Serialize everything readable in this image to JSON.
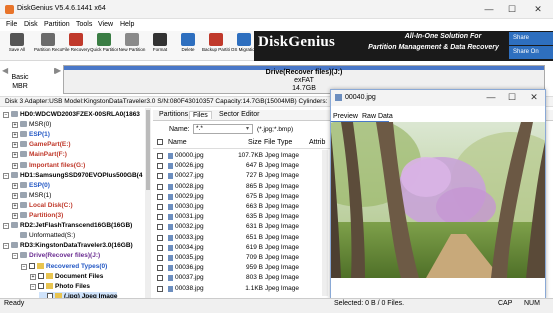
{
  "window": {
    "title": "DiskGenius V5.4.6.1441 x64",
    "min": "—",
    "max": "☐",
    "close": "✕"
  },
  "menu": [
    "File",
    "Disk",
    "Partition",
    "Tools",
    "View",
    "Help"
  ],
  "toolbar": [
    {
      "label": "Save All",
      "icon": "save-icon",
      "color": "#555555"
    },
    {
      "label": "Partition Recovery",
      "icon": "partition-recovery-icon",
      "color": "#6b6b6b"
    },
    {
      "label": "File Recovery",
      "icon": "file-recovery-icon",
      "color": "#c0392b"
    },
    {
      "label": "Quick Partition",
      "icon": "quick-partition-icon",
      "color": "#3a7d44"
    },
    {
      "label": "New Partition",
      "icon": "new-partition-icon",
      "color": "#8a8a8a"
    },
    {
      "label": "Format",
      "icon": "format-icon",
      "color": "#333333"
    },
    {
      "label": "Delete",
      "icon": "delete-icon",
      "color": "#2e6fbf"
    },
    {
      "label": "Backup Partition",
      "icon": "backup-partition-icon",
      "color": "#c0392b"
    },
    {
      "label": "OS Migration",
      "icon": "os-migration-icon",
      "color": "#2e6fbf"
    }
  ],
  "banner": {
    "brand": "DiskGenius",
    "tagline1": "All-In-One Solution For",
    "tagline2": "Partition Management & Data Recovery",
    "social": [
      "Share",
      "Share On"
    ]
  },
  "diskmap": {
    "basic": "Basic",
    "mbr": "MBR",
    "partition_name": "Drive(Recover files)(J:)",
    "partition_fs": "exFAT",
    "partition_size": "14.7GB"
  },
  "disk_info": "Disk 3 Adapter:USB  Model:KingstonDataTraveler3.0  S/N:080F43010357  Capacity:14.7GB(15004MB)  Cylinders:",
  "tree": [
    {
      "label": "HD0:WDCWD2003FZEX-00SRLA0(1863",
      "kind": "disk",
      "pm": "-",
      "indent": 0,
      "color": ""
    },
    {
      "label": "MSR(0)",
      "kind": "part",
      "pm": "+",
      "indent": 1,
      "color": ""
    },
    {
      "label": "ESP(1)",
      "kind": "part",
      "pm": "+",
      "indent": 1,
      "color": "blue"
    },
    {
      "label": "GamePart(E:)",
      "kind": "part",
      "pm": "+",
      "indent": 1,
      "color": "red"
    },
    {
      "label": "MainPart(F:)",
      "kind": "part",
      "pm": "+",
      "indent": 1,
      "color": "red"
    },
    {
      "label": "Important files(G:)",
      "kind": "part",
      "pm": "+",
      "indent": 1,
      "color": "red"
    },
    {
      "label": "HD1:SamsungSSD970EVOPlus500GB(4",
      "kind": "disk",
      "pm": "-",
      "indent": 0,
      "color": ""
    },
    {
      "label": "ESP(0)",
      "kind": "part",
      "pm": "+",
      "indent": 1,
      "color": "blue"
    },
    {
      "label": "MSR(1)",
      "kind": "part",
      "pm": "+",
      "indent": 1,
      "color": ""
    },
    {
      "label": "Local Disk(C:)",
      "kind": "part",
      "pm": "+",
      "indent": 1,
      "color": "red"
    },
    {
      "label": "Partition(3)",
      "kind": "part",
      "pm": "+",
      "indent": 1,
      "color": "red"
    },
    {
      "label": "RD2:JetFlashTranscend16GB(16GB)",
      "kind": "disk",
      "pm": "-",
      "indent": 0,
      "color": ""
    },
    {
      "label": "Unformatted(S:)",
      "kind": "part",
      "pm": "",
      "indent": 1,
      "color": ""
    },
    {
      "label": "RD3:KingstonDataTraveler3.0(16GB)",
      "kind": "disk",
      "pm": "-",
      "indent": 0,
      "color": ""
    },
    {
      "label": "Drive(Recover files)(J:)",
      "kind": "part",
      "pm": "-",
      "indent": 1,
      "color": "purple"
    },
    {
      "label": "Recovered Types(0)",
      "kind": "folder",
      "pm": "-",
      "indent": 2,
      "color": "blue",
      "cb": true
    },
    {
      "label": "Document Files",
      "kind": "folder",
      "pm": "+",
      "indent": 3,
      "color": "",
      "cb": true
    },
    {
      "label": "Photo Files",
      "kind": "folder",
      "pm": "-",
      "indent": 3,
      "color": "",
      "cb": true
    },
    {
      "label": "(.jpg) Jpeg Image",
      "kind": "folder",
      "pm": "",
      "indent": 4,
      "color": "",
      "cb": true,
      "hl": true
    }
  ],
  "tabs": [
    "Partitions",
    "Files",
    "Sector Editor"
  ],
  "active_tab": 1,
  "filter": {
    "label": "Name:",
    "value": "*.*",
    "hint": "(*.jpg;*.bmp)"
  },
  "columns": [
    "Name",
    "Size",
    "File Type",
    "Attrib"
  ],
  "files": [
    {
      "name": "00000.jpg",
      "size": "107.7KB",
      "type": "Jpeg Image"
    },
    {
      "name": "00026.jpg",
      "size": "647 B",
      "type": "Jpeg Image"
    },
    {
      "name": "00027.jpg",
      "size": "727 B",
      "type": "Jpeg Image"
    },
    {
      "name": "00028.jpg",
      "size": "865 B",
      "type": "Jpeg Image"
    },
    {
      "name": "00029.jpg",
      "size": "675 B",
      "type": "Jpeg Image"
    },
    {
      "name": "00030.jpg",
      "size": "663 B",
      "type": "Jpeg Image"
    },
    {
      "name": "00031.jpg",
      "size": "635 B",
      "type": "Jpeg Image"
    },
    {
      "name": "00032.jpg",
      "size": "631 B",
      "type": "Jpeg Image"
    },
    {
      "name": "00033.jpg",
      "size": "651 B",
      "type": "Jpeg Image"
    },
    {
      "name": "00034.jpg",
      "size": "619 B",
      "type": "Jpeg Image"
    },
    {
      "name": "00035.jpg",
      "size": "709 B",
      "type": "Jpeg Image"
    },
    {
      "name": "00036.jpg",
      "size": "959 B",
      "type": "Jpeg Image"
    },
    {
      "name": "00037.jpg",
      "size": "803 B",
      "type": "Jpeg Image"
    },
    {
      "name": "00038.jpg",
      "size": "1.1KB",
      "type": "Jpeg Image"
    }
  ],
  "preview": {
    "title": "00040.jpg",
    "tab_preview": "Preview",
    "tab_raw": "Raw Data"
  },
  "status": {
    "ready": "Ready",
    "selected": "Selected: 0 B / 0 Files.",
    "cap": "CAP",
    "num": "NUM"
  }
}
